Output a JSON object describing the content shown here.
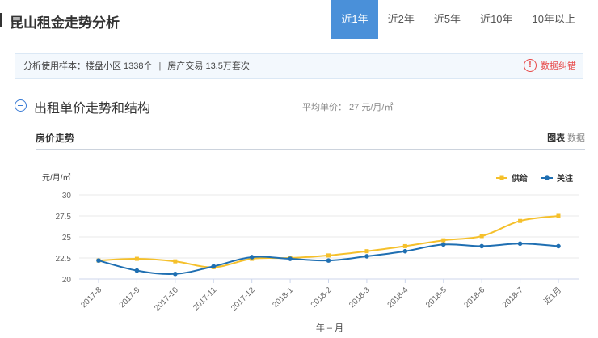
{
  "header": {
    "title": "昆山租金走势分析",
    "tabs": [
      {
        "label": "近1年",
        "active": true
      },
      {
        "label": "近2年",
        "active": false
      },
      {
        "label": "近5年",
        "active": false
      },
      {
        "label": "近10年",
        "active": false
      },
      {
        "label": "10年以上",
        "active": false
      }
    ]
  },
  "info": {
    "sample_text": "分析使用样本：楼盘小区 1338个",
    "separator": "|",
    "trade_text": "房产交易 13.5万套次",
    "report_label": "数据纠错",
    "report_icon": "!"
  },
  "section": {
    "title": "出租单价走势和结构",
    "avg_price": "平均单价： 27 元/月/㎡"
  },
  "chart_panel": {
    "title": "房价走势",
    "view_chart": "图表",
    "view_sep": "|",
    "view_data": "数据"
  },
  "colors": {
    "accent": "#4a90d9",
    "supply": "#f5c02b",
    "attention": "#1f6fb2",
    "warning": "#e84a4a"
  },
  "chart_data": {
    "type": "line",
    "ylabel": "元/月/㎡",
    "xlabel": "年 – 月",
    "ylim": [
      20,
      30
    ],
    "yticks": [
      20,
      22.5,
      25,
      27.5,
      30
    ],
    "ytick_labels": [
      "20",
      "22.5",
      "25",
      "27.5",
      "30"
    ],
    "categories": [
      "2017-8",
      "2017-9",
      "2017-10",
      "2017-11",
      "2017-12",
      "2018-1",
      "2018-2",
      "2018-3",
      "2018-4",
      "2018-5",
      "2018-6",
      "2018-7",
      "近1月"
    ],
    "legend_position": "top-right",
    "grid": true,
    "series": [
      {
        "name": "供给",
        "color": "#f5c02b",
        "marker": "square",
        "values": [
          22.2,
          22.4,
          22.1,
          21.4,
          22.4,
          22.5,
          22.8,
          23.3,
          23.9,
          24.6,
          25.1,
          26.9,
          27.5
        ]
      },
      {
        "name": "关注",
        "color": "#1f6fb2",
        "marker": "circle",
        "values": [
          22.2,
          21.0,
          20.6,
          21.5,
          22.6,
          22.4,
          22.2,
          22.7,
          23.3,
          24.1,
          23.9,
          24.2,
          23.9
        ]
      }
    ]
  }
}
